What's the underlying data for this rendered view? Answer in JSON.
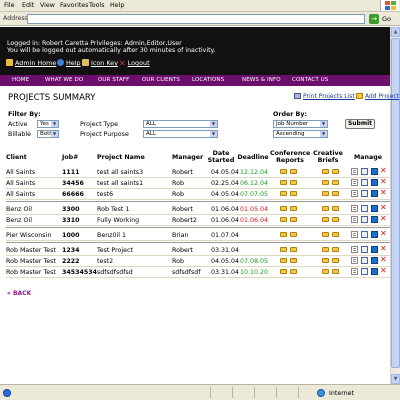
{
  "menubar": {
    "file": "File",
    "edit": "Edit",
    "view": "View",
    "favorites": "Favorites",
    "tools": "Tools",
    "help": "Help"
  },
  "addressbar": {
    "label": "Address",
    "value": "",
    "go_label": "Go"
  },
  "login": {
    "line1": "Logged in: Robert Caretta   Privileges: Admin,Editor,User",
    "line2": "You will be logged out automatically after 30 minutes of inactivity.",
    "admin_home": "Admin Home",
    "help": "Help",
    "icon_key": "Icon Key",
    "logout": "Logout"
  },
  "nav": {
    "home": "HOME",
    "what_we_do": "WHAT WE DO",
    "our_staff": "OUR STAFF",
    "our_clients": "OUR CLIENTS",
    "locations": "LOCATIONS",
    "news_info": "NEWS & INFO",
    "contact_us": "CONTACT US"
  },
  "page": {
    "title": "PROJECTS SUMMARY",
    "print_link": "Print Projects List",
    "add_link": "Add Project"
  },
  "filters": {
    "filter_by": "Filter By:",
    "active_label": "Active",
    "active_value": "Yes",
    "billable_label": "Billable",
    "billable_value": "Both",
    "project_type_label": "Project Type",
    "project_type_value": "ALL",
    "project_purpose_label": "Project Purpose",
    "project_purpose_value": "ALL",
    "order_by": "Order By:",
    "order_field": "Job Number",
    "order_dir": "Ascending",
    "submit": "Submit"
  },
  "table": {
    "headers": {
      "client": "Client",
      "job": "Job#",
      "project_name": "Project Name",
      "manager": "Manager",
      "date_started_1": "Date",
      "date_started_2": "Started",
      "deadline": "Deadline",
      "conf_1": "Conference",
      "conf_2": "Reports",
      "creative_1": "Creative",
      "creative_2": "Briefs",
      "manage": "Manage"
    },
    "rows": [
      {
        "client": "All Saints",
        "job": "1111",
        "name": "test all saints3",
        "manager": "Robert",
        "started": "04.05.04",
        "deadline": "12.12.04",
        "overdue": false
      },
      {
        "client": "All Saints",
        "job": "34456",
        "name": "test all saints1",
        "manager": "Rob",
        "started": "02.25.04",
        "deadline": "06.12.04",
        "overdue": false
      },
      {
        "client": "All Saints",
        "job": "66666",
        "name": "test6",
        "manager": "Rob",
        "started": "04.05.04",
        "deadline": "07.07.05",
        "overdue": false
      },
      {
        "client": "Benz Oil",
        "job": "3300",
        "name": "Rob Test 1",
        "manager": "Robert",
        "started": "01.06.04",
        "deadline": "01.05.04",
        "overdue": true
      },
      {
        "client": "Benz Oil",
        "job": "3310",
        "name": "Fully Working",
        "manager": "Robert2",
        "started": "01.06.04",
        "deadline": "01.06.04",
        "overdue": true
      },
      {
        "client": "Pier Wisconsin",
        "job": "1000",
        "name": "Benz0il 1",
        "manager": "Brian",
        "started": "01.07.04",
        "deadline": "",
        "overdue": false
      },
      {
        "client": "Rob Master Test",
        "job": "1234",
        "name": "Test Project",
        "manager": "Robert",
        "started": "03.31.04",
        "deadline": "",
        "overdue": false
      },
      {
        "client": "Rob Master Test",
        "job": "2222",
        "name": "test2",
        "manager": "Rob",
        "started": "04.05.04",
        "deadline": "07.08.05",
        "overdue": false
      },
      {
        "client": "Rob Master Test",
        "job": "34534534",
        "name": "sdfsdfsdfsd",
        "manager": "sdfsdfsdf",
        "started": "03.31.04",
        "deadline": "10.10.20",
        "overdue": false
      }
    ]
  },
  "back": "« BACK",
  "status": {
    "zone": "Internet"
  },
  "colors": {
    "nav_bg": "#6c0f6c",
    "deadline_ok": "#1c9a1c",
    "deadline_overdue": "#d8131a"
  }
}
